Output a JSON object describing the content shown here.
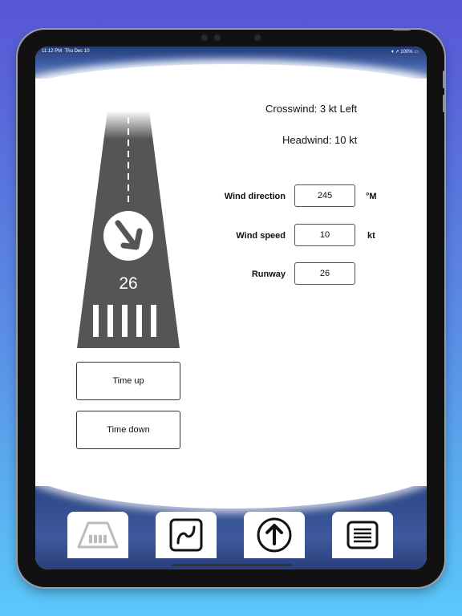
{
  "status_bar": {
    "time": "11:12 PM",
    "date": "Thu Dec 10",
    "battery": "100%"
  },
  "results": {
    "crosswind": "Crosswind: 3 kt Left",
    "headwind": "Headwind: 10 kt"
  },
  "runway_graphic": {
    "number": "26",
    "wind_arrow_icon": "arrow-down-right-icon"
  },
  "inputs": {
    "wind_direction": {
      "label": "Wind direction",
      "value": "245",
      "unit": "°M"
    },
    "wind_speed": {
      "label": "Wind speed",
      "value": "10",
      "unit": "kt"
    },
    "runway": {
      "label": "Runway",
      "value": "26"
    }
  },
  "buttons": {
    "time_up": "Time up",
    "time_down": "Time down",
    "clear": "✕"
  },
  "tab_bar": {
    "tabs": [
      {
        "icon": "runway-icon",
        "active": false
      },
      {
        "icon": "curve-icon",
        "active": true
      },
      {
        "icon": "arrow-up-circle-icon",
        "active": true
      },
      {
        "icon": "list-icon",
        "active": true
      }
    ]
  },
  "colors": {
    "runway": "#555555",
    "band": "#3e5a9e",
    "bg_top": "#5856d6",
    "bg_bottom": "#5ac8fa"
  }
}
